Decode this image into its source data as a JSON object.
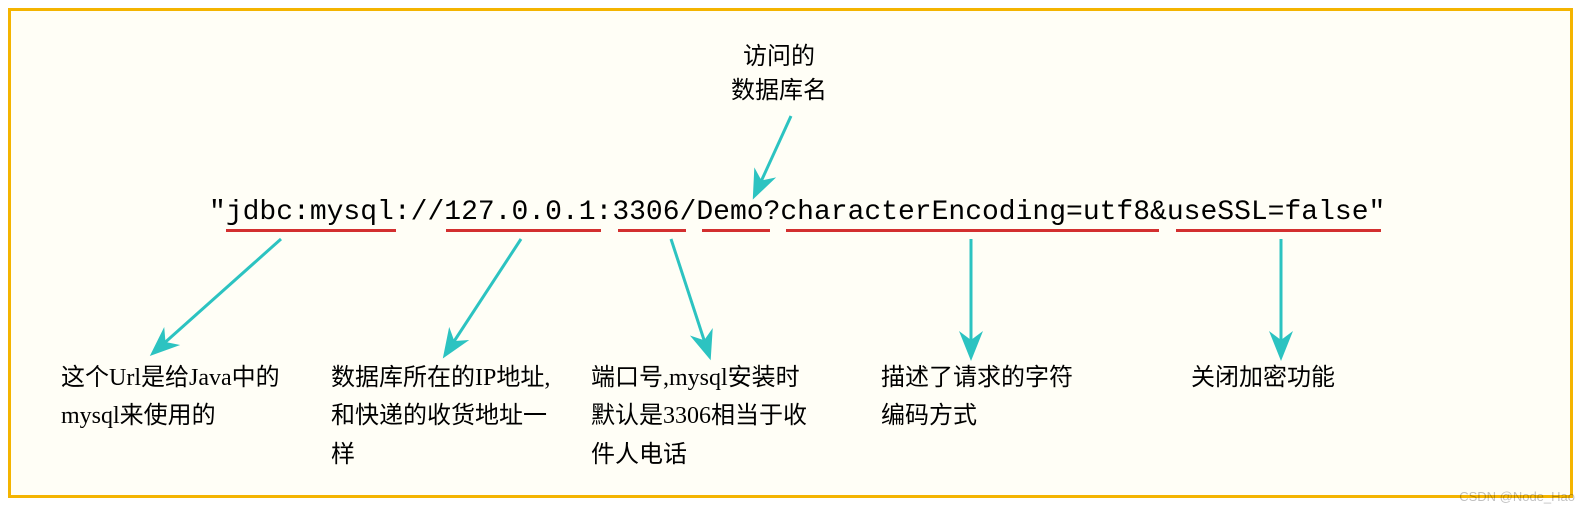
{
  "topLabel": {
    "line1": "访问的",
    "line2": "数据库名"
  },
  "url": {
    "quoteOpen": "\"",
    "scheme": "jdbc:mysql",
    "sep1": "://",
    "host": "127.0.0.1",
    "colon": ":",
    "port": "3306",
    "slash": "/",
    "db": "Demo",
    "qmark": "?",
    "encoding": "characterEncoding=utf8",
    "amp": "&",
    "ssl": "useSSL=false",
    "quoteClose": "\""
  },
  "descriptions": {
    "scheme": "这个Url是给Java中的mysql来使用的",
    "host": "数据库所在的IP地址,和快递的收货地址一样",
    "port": "端口号,mysql安装时默认是3306相当于收件人电话",
    "encoding": "描述了请求的字符编码方式",
    "ssl": "关闭加密功能"
  },
  "watermark": "CSDN @Node_Hao",
  "colors": {
    "arrow": "#2cc3c1",
    "underline": "#d32f2f",
    "border": "#f4b400"
  }
}
